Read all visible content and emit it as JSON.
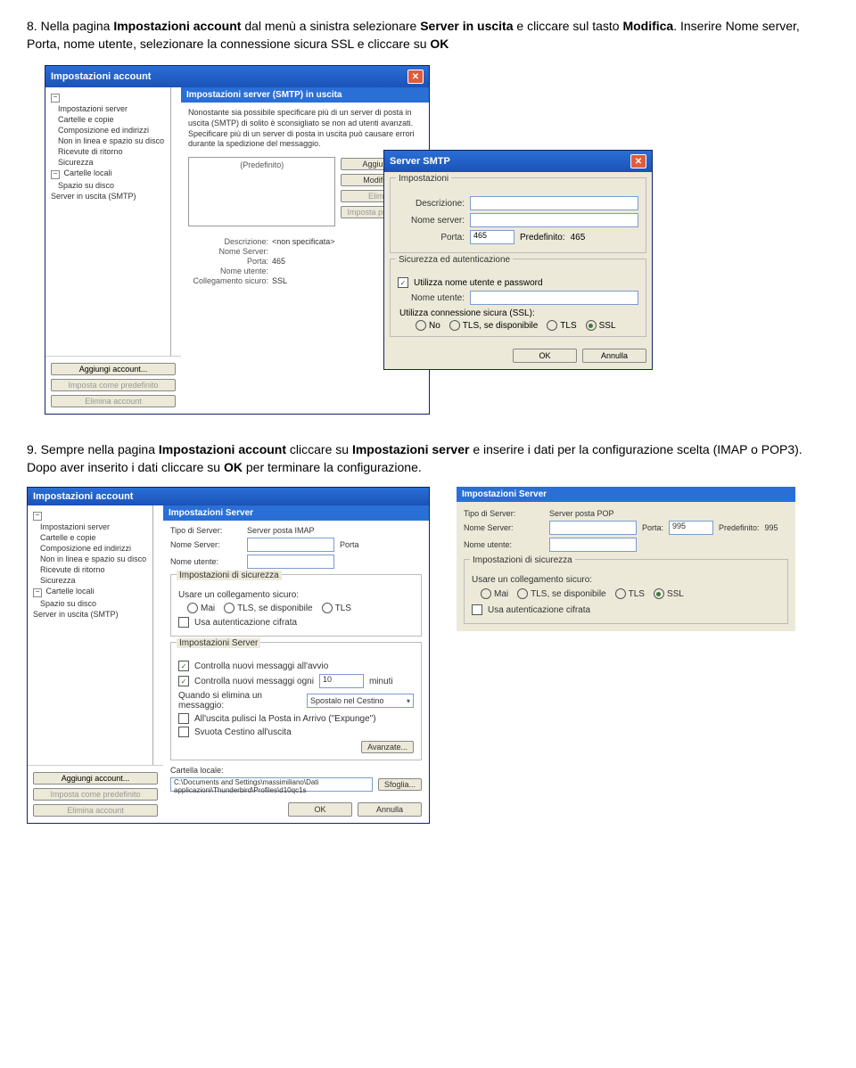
{
  "step8": {
    "num": "8.",
    "text_before": " Nella pagina ",
    "bold1": "Impostazioni account",
    "text_mid1": " dal menù a sinistra selezionare ",
    "bold2": "Server in uscita",
    "text_mid2": " e cliccare sul tasto ",
    "bold3": "Modifica",
    "text_end": ". Inserire Nome server, Porta, nome utente, selezionare la connessione sicura SSL e cliccare su ",
    "bold4": "OK"
  },
  "step9": {
    "num": "9.",
    "text_before": " Sempre nella pagina ",
    "bold1": "Impostazioni account",
    "text_mid1": " cliccare su ",
    "bold2": "Impostazioni server",
    "text_mid2": " e inserire i dati per la configurazione scelta (IMAP o POP3). Dopo aver inserito i dati cliccare su ",
    "bold3": "OK",
    "text_end": " per terminare la configurazione."
  },
  "accountWin": {
    "title": "Impostazioni account",
    "sidebar": {
      "items": [
        "Impostazioni server",
        "Cartelle e copie",
        "Composizione ed indirizzi",
        "Non in linea e spazio su disco",
        "Ricevute di ritorno",
        "Sicurezza"
      ],
      "local": "Cartelle locali",
      "localSub": "Spazio su disco",
      "smtp": "Server in uscita (SMTP)",
      "addAccount": "Aggiungi account...",
      "setDefault": "Imposta come predefinito",
      "removeAccount": "Elimina account"
    },
    "smtpPanel": {
      "header": "Impostazioni server (SMTP) in uscita",
      "desc": "Nonostante sia possibile specificare più di un server di posta in uscita (SMTP) di solito è sconsigliato se non ad utenti avanzati. Specificare più di un server di posta in uscita può causare errori durante la spedizione del messaggio.",
      "defaultLabel": "(Predefinito)",
      "btns": {
        "add": "Aggiungi...",
        "edit": "Modifica...",
        "del": "Elimina",
        "setdef": "Imposta predefinito"
      },
      "details": {
        "desc": "Descrizione:",
        "descV": "<non specificata>",
        "name": "Nome Server:",
        "port": "Porta:",
        "portV": "465",
        "user": "Nome utente:",
        "sec": "Collegamento sicuro:",
        "secV": "SSL"
      }
    }
  },
  "smtpDialog": {
    "title": "Server SMTP",
    "g1": "Impostazioni",
    "g2": "Sicurezza ed autenticazione",
    "labels": {
      "desc": "Descrizione:",
      "name": "Nome server:",
      "port": "Porta:",
      "predef": "Predefinito:",
      "predefV": "465",
      "portV": "465",
      "useAuth": "Utilizza nome utente e password",
      "user": "Nome utente:",
      "ssl": "Utilizza connessione sicura (SSL):"
    },
    "radios": {
      "no": "No",
      "tlsd": "TLS, se disponibile",
      "tls": "TLS",
      "ssl": "SSL"
    },
    "ok": "OK",
    "cancel": "Annulla"
  },
  "imapPanel": {
    "header": "Impostazioni Server",
    "type": "Tipo di Server:",
    "typeV": "Server posta IMAP",
    "name": "Nome Server:",
    "port": "Porta",
    "user": "Nome utente:",
    "secHdr": "Impostazioni di sicurezza",
    "secLink": "Usare un collegamento sicuro:",
    "radios": {
      "mai": "Mai",
      "tlsd": "TLS, se disponibile",
      "tls": "TLS"
    },
    "cifrata": "Usa autenticazione cifrata",
    "srvHdr": "Impostazioni Server",
    "check1": "Controlla nuovi messaggi all'avvio",
    "check2": "Controlla nuovi messaggi ogni",
    "check2min": "10",
    "check2unit": "minuti",
    "del": "Quando si elimina un messaggio:",
    "delV": "Spostalo nel Cestino",
    "expunge": "All'uscita pulisci la Posta in Arrivo (\"Expunge\")",
    "empty": "Svuota Cestino all'uscita",
    "advanced": "Avanzate...",
    "local": "Cartella locale:",
    "localV": "C:\\Documents and Settings\\massimiliano\\Dati applicazioni\\Thunderbird\\Profiles\\d10qc1s",
    "browse": "Sfoglia...",
    "ok": "OK",
    "cancel": "Annulla"
  },
  "popPanel": {
    "header": "Impostazioni Server",
    "type": "Tipo di Server:",
    "typeV": "Server posta POP",
    "name": "Nome Server:",
    "port": "Porta:",
    "portV": "995",
    "predef": "Predefinito:",
    "predefV": "995",
    "user": "Nome utente:",
    "secHdr": "Impostazioni di sicurezza",
    "secLink": "Usare un collegamento sicuro:",
    "radios": {
      "mai": "Mai",
      "tlsd": "TLS, se disponibile",
      "tls": "TLS",
      "ssl": "SSL"
    },
    "cifrata": "Usa autenticazione cifrata"
  }
}
